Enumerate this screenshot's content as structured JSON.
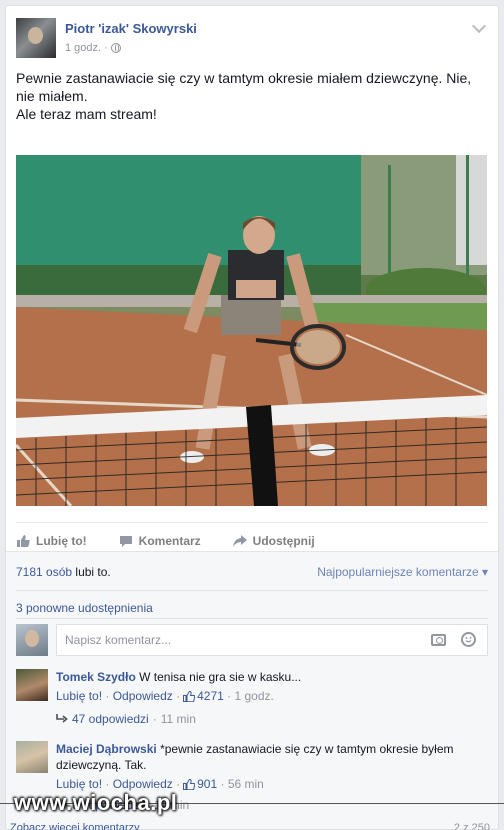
{
  "post": {
    "author": "Piotr 'izak' Skowyrski",
    "time": "1 godz.",
    "text_lines": [
      "Pewnie zastanawiacie się czy w tamtym okresie miałem dziewczynę. Nie, nie miałem.",
      "Ale teraz mam stream!"
    ]
  },
  "actions": {
    "like": "Lubię to!",
    "comment": "Komentarz",
    "share": "Udostępnij"
  },
  "stats": {
    "likes_count": "7181 osób",
    "likes_suffix": "lubi to.",
    "sort": "Najpopularniejsze komentarze",
    "shares": "3 ponowne udostępnienia"
  },
  "compose": {
    "placeholder": "Napisz komentarz..."
  },
  "comments": [
    {
      "author": "Tomek Szydło",
      "text": "W tenisa nie gra sie w kasku...",
      "like": "Lubię to!",
      "reply": "Odpowiedz",
      "likes": "4271",
      "time": "1 godz.",
      "replies_label": "47 odpowiedzi",
      "replies_time": "11 min"
    },
    {
      "author": "Maciej Dąbrowski",
      "text": "*pewnie zastanawiacie się czy w tamtym okresie byłem dziewczyną. Tak.",
      "like": "Lubię to!",
      "reply": "Odpowiedz",
      "likes": "901",
      "time": "56 min",
      "replies_label": "8 odpowiedzi",
      "replies_time": "11 min"
    }
  ],
  "footer": {
    "more": "Zobacz więcej komentarzy",
    "count": "2 z 250"
  },
  "watermark": "www.wiocha.pl",
  "colors": {
    "link": "#3b5998",
    "muted": "#90949c"
  }
}
